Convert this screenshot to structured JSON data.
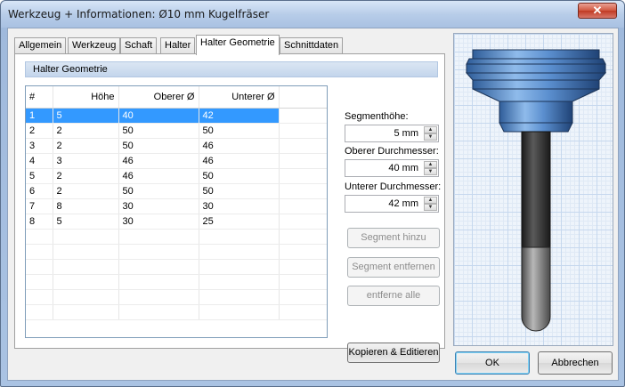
{
  "window": {
    "title": "Werkzeug + Informationen: Ø10 mm Kugelfräser",
    "close_glyph": "✕"
  },
  "tabs": [
    {
      "label": "Allgemein"
    },
    {
      "label": "Werkzeug"
    },
    {
      "label": "Schaft"
    },
    {
      "label": "Halter"
    },
    {
      "label": "Halter Geometrie",
      "active": true
    },
    {
      "label": "Schnittdaten"
    }
  ],
  "group_title": "Halter Geometrie",
  "grid": {
    "headers": [
      "#",
      "Höhe",
      "Oberer  Ø",
      "Unterer  Ø"
    ],
    "rows": [
      [
        "1",
        "5",
        "40",
        "42"
      ],
      [
        "2",
        "2",
        "50",
        "50"
      ],
      [
        "3",
        "2",
        "50",
        "46"
      ],
      [
        "4",
        "3",
        "46",
        "46"
      ],
      [
        "5",
        "2",
        "46",
        "50"
      ],
      [
        "6",
        "2",
        "50",
        "50"
      ],
      [
        "7",
        "8",
        "30",
        "30"
      ],
      [
        "8",
        "5",
        "30",
        "25"
      ]
    ],
    "selected_row": 0
  },
  "fields": {
    "segment_height": {
      "label": "Segmenthöhe:",
      "value": "5 mm"
    },
    "upper_diameter": {
      "label": "Oberer Durchmesser:",
      "value": "40 mm"
    },
    "lower_diameter": {
      "label": "Unterer Durchmesser:",
      "value": "42 mm"
    }
  },
  "buttons": {
    "add_segment": "Segment hinzu",
    "remove_segment": "Segment entfernen",
    "remove_all": "entferne alle",
    "copy_edit": "Kopieren & Editieren",
    "ok": "OK",
    "cancel": "Abbrechen"
  },
  "colors": {
    "selection": "#3399ff",
    "holder_blue": "#5b8fcf",
    "shank_dark": "#2e2e2e",
    "tip_grey": "#8a8a8a"
  }
}
